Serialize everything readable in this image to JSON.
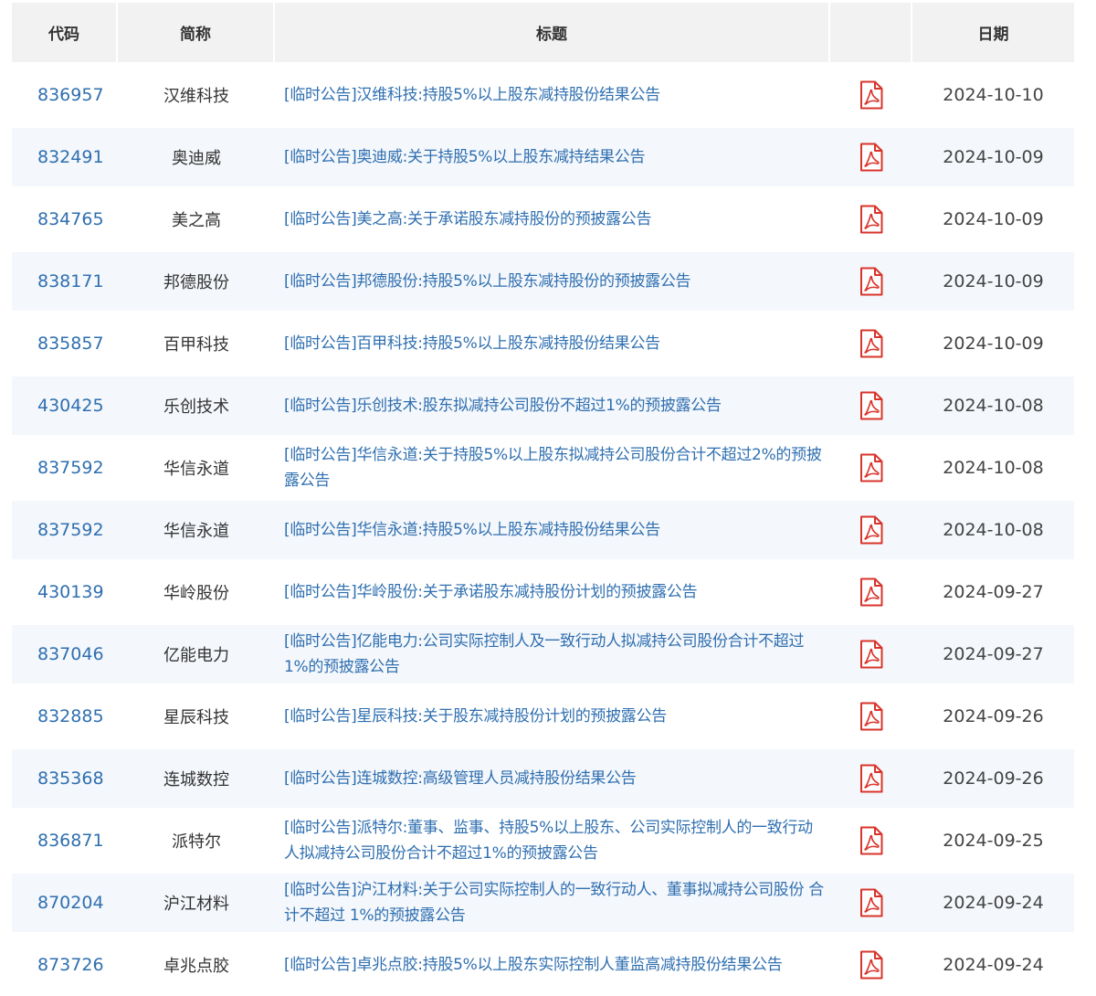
{
  "table": {
    "headers": {
      "code": "代码",
      "name": "简称",
      "title": "标题",
      "pdf": "",
      "date": "日期"
    },
    "rows": [
      {
        "code": "836957",
        "name": "汉维科技",
        "title": "[临时公告]汉维科技:持股5%以上股东减持股份结果公告",
        "date": "2024-10-10"
      },
      {
        "code": "832491",
        "name": "奥迪威",
        "title": "[临时公告]奥迪威:关于持股5%以上股东减持结果公告",
        "date": "2024-10-09"
      },
      {
        "code": "834765",
        "name": "美之高",
        "title": "[临时公告]美之高:关于承诺股东减持股份的预披露公告",
        "date": "2024-10-09"
      },
      {
        "code": "838171",
        "name": "邦德股份",
        "title": "[临时公告]邦德股份:持股5%以上股东减持股份的预披露公告",
        "date": "2024-10-09"
      },
      {
        "code": "835857",
        "name": "百甲科技",
        "title": "[临时公告]百甲科技:持股5%以上股东减持股份结果公告",
        "date": "2024-10-09"
      },
      {
        "code": "430425",
        "name": "乐创技术",
        "title": "[临时公告]乐创技术:股东拟减持公司股份不超过1%的预披露公告",
        "date": "2024-10-08"
      },
      {
        "code": "837592",
        "name": "华信永道",
        "title": "[临时公告]华信永道:关于持股5%以上股东拟减持公司股份合计不超过2%的预披露公告",
        "date": "2024-10-08"
      },
      {
        "code": "837592",
        "name": "华信永道",
        "title": "[临时公告]华信永道:持股5%以上股东减持股份结果公告",
        "date": "2024-10-08"
      },
      {
        "code": "430139",
        "name": "华岭股份",
        "title": "[临时公告]华岭股份:关于承诺股东减持股份计划的预披露公告",
        "date": "2024-09-27"
      },
      {
        "code": "837046",
        "name": "亿能电力",
        "title": "[临时公告]亿能电力:公司实际控制人及一致行动人拟减持公司股份合计不超过 1%的预披露公告",
        "date": "2024-09-27"
      },
      {
        "code": "832885",
        "name": "星辰科技",
        "title": "[临时公告]星辰科技:关于股东减持股份计划的预披露公告",
        "date": "2024-09-26"
      },
      {
        "code": "835368",
        "name": "连城数控",
        "title": "[临时公告]连城数控:高级管理人员减持股份结果公告",
        "date": "2024-09-26"
      },
      {
        "code": "836871",
        "name": "派特尔",
        "title": "[临时公告]派特尔:董事、监事、持股5%以上股东、公司实际控制人的一致行动人拟减持公司股份合计不超过1%的预披露公告",
        "date": "2024-09-25"
      },
      {
        "code": "870204",
        "name": "沪江材料",
        "title": "[临时公告]沪江材料:关于公司实际控制人的一致行动人、董事拟减持公司股份 合计不超过 1%的预披露公告",
        "date": "2024-09-24"
      },
      {
        "code": "873726",
        "name": "卓兆点胶",
        "title": "[临时公告]卓兆点胶:持股5%以上股东实际控制人董监高减持股份结果公告",
        "date": "2024-09-24"
      }
    ]
  },
  "icons": {
    "pdf": "pdf-icon"
  },
  "colors": {
    "link": "#2f6fb0",
    "pdf_red": "#d9342b",
    "header_bg": "#f2f2f2",
    "alt_row_bg": "#f4f7fb"
  }
}
